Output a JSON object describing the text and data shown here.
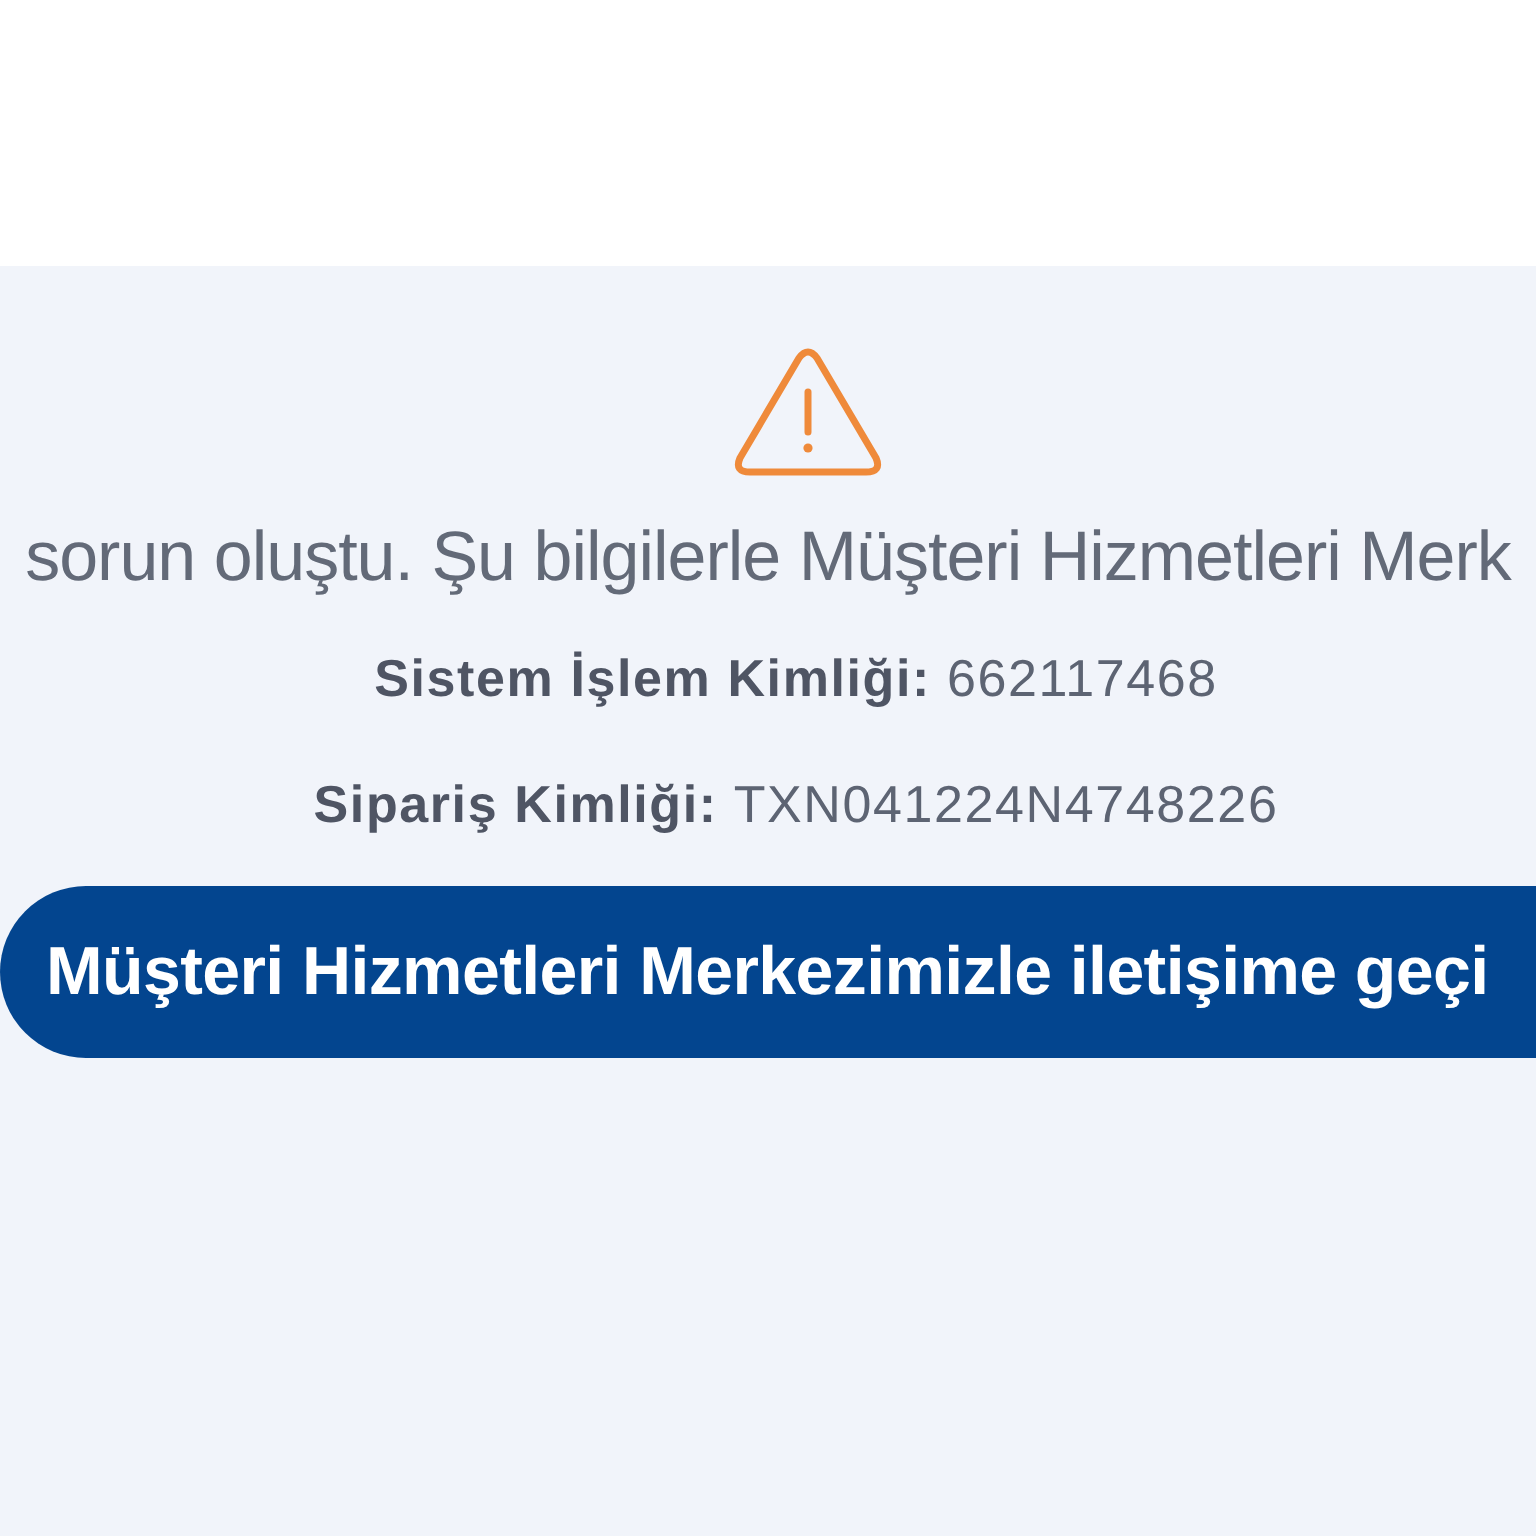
{
  "alert": {
    "message": "sorun oluştu. Şu bilgilerle Müşteri Hizmetleri Merk",
    "details": [
      {
        "label": "Sistem İşlem Kimliği:",
        "value": "662117468"
      },
      {
        "label": "Sipariş Kimliği:",
        "value": "TXN041224N4748226"
      }
    ],
    "button": {
      "label": "Müşteri Hizmetleri Merkezimizle iletişime geçi"
    }
  }
}
